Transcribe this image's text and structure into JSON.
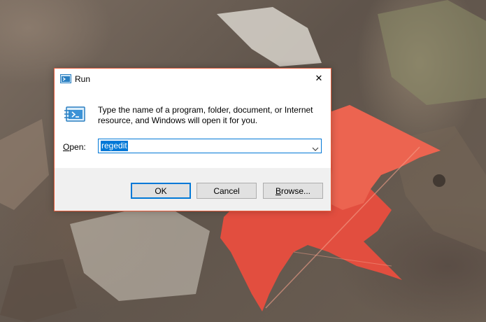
{
  "dialog": {
    "title": "Run",
    "close_label": "✕",
    "description": "Type the name of a program, folder, document, or Internet resource, and Windows will open it for you.",
    "open_label_accel": "O",
    "open_label_rest": "pen:",
    "open_value": "regedit",
    "buttons": {
      "ok": "OK",
      "cancel": "Cancel",
      "browse_accel": "B",
      "browse_rest": "rowse..."
    }
  },
  "colors": {
    "accent": "#0078d7",
    "border": "#e65c3b",
    "footer": "#f0f0f0"
  },
  "icons": [
    "run-icon",
    "close-icon",
    "run-large-icon",
    "chevron-down-icon"
  ]
}
